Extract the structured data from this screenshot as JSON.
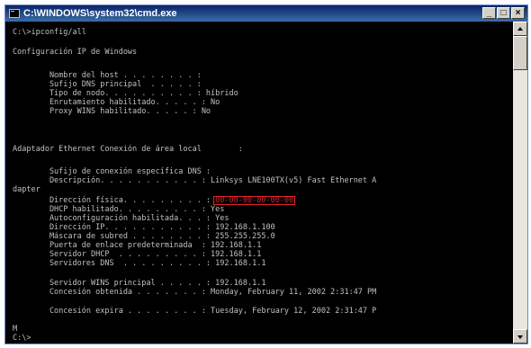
{
  "window": {
    "title": "C:\\WINDOWS\\system32\\cmd.exe",
    "controls": {
      "minimize": "_",
      "maximize": "□",
      "close": "×"
    }
  },
  "console": {
    "lines": [
      "C:\\>ipconfig/all",
      "Configuración IP de Windows",
      "        Nombre del host . . . . . . . . :",
      "        Sufijo DNS principal  . . . . . :",
      "        Tipo de nodo. . . . . . . . . . : híbrido",
      "        Enrutamiento habilitado. . . . . : No",
      "        Proxy WINS habilitado. . . . . : No",
      "Adaptador Ethernet Conexión de área local        :",
      "        Sufijo de conexión específica DNS :",
      "        Descripción. . . . . . . . . . . : Linksys LNE100TX(v5) Fast Ethernet A",
      "dapter",
      "        Dirección física. . . . . . . . . : 00-00-00-00-00-00",
      "        DHCP habilitado. . . . . . . . . : Yes",
      "        Autoconfiguración habilitada. . . : Yes",
      "        Dirección IP. . . . . . . . . . . : 192.168.1.100",
      "        Máscara de subred . . . . . . . . : 255.255.255.0",
      "        Puerta de enlace predeterminada  : 192.168.1.1",
      "        Servidor DHCP  . . . . . . . . . : 192.168.1.1",
      "        Servidores DNS  . . . . . . . . . : 192.168.1.1",
      "        Servidor WINS principal . . . . . : 192.168.1.1",
      "        Concesión obtenida . . . . . . . : Monday, February 11, 2002 2:31:47 PM",
      "        Concesión expira . . . . . . . . : Tuesday, February 12, 2002 2:31:47 P",
      "M",
      "C:\\>"
    ],
    "highlight": {
      "text": "00-00-00-00-00-00",
      "color": "#e0202a"
    },
    "text_color": "#c0c0c0",
    "background_color": "#000000"
  },
  "scrollbar": {
    "up_icon": "arrow-up-icon",
    "down_icon": "arrow-down-icon"
  }
}
